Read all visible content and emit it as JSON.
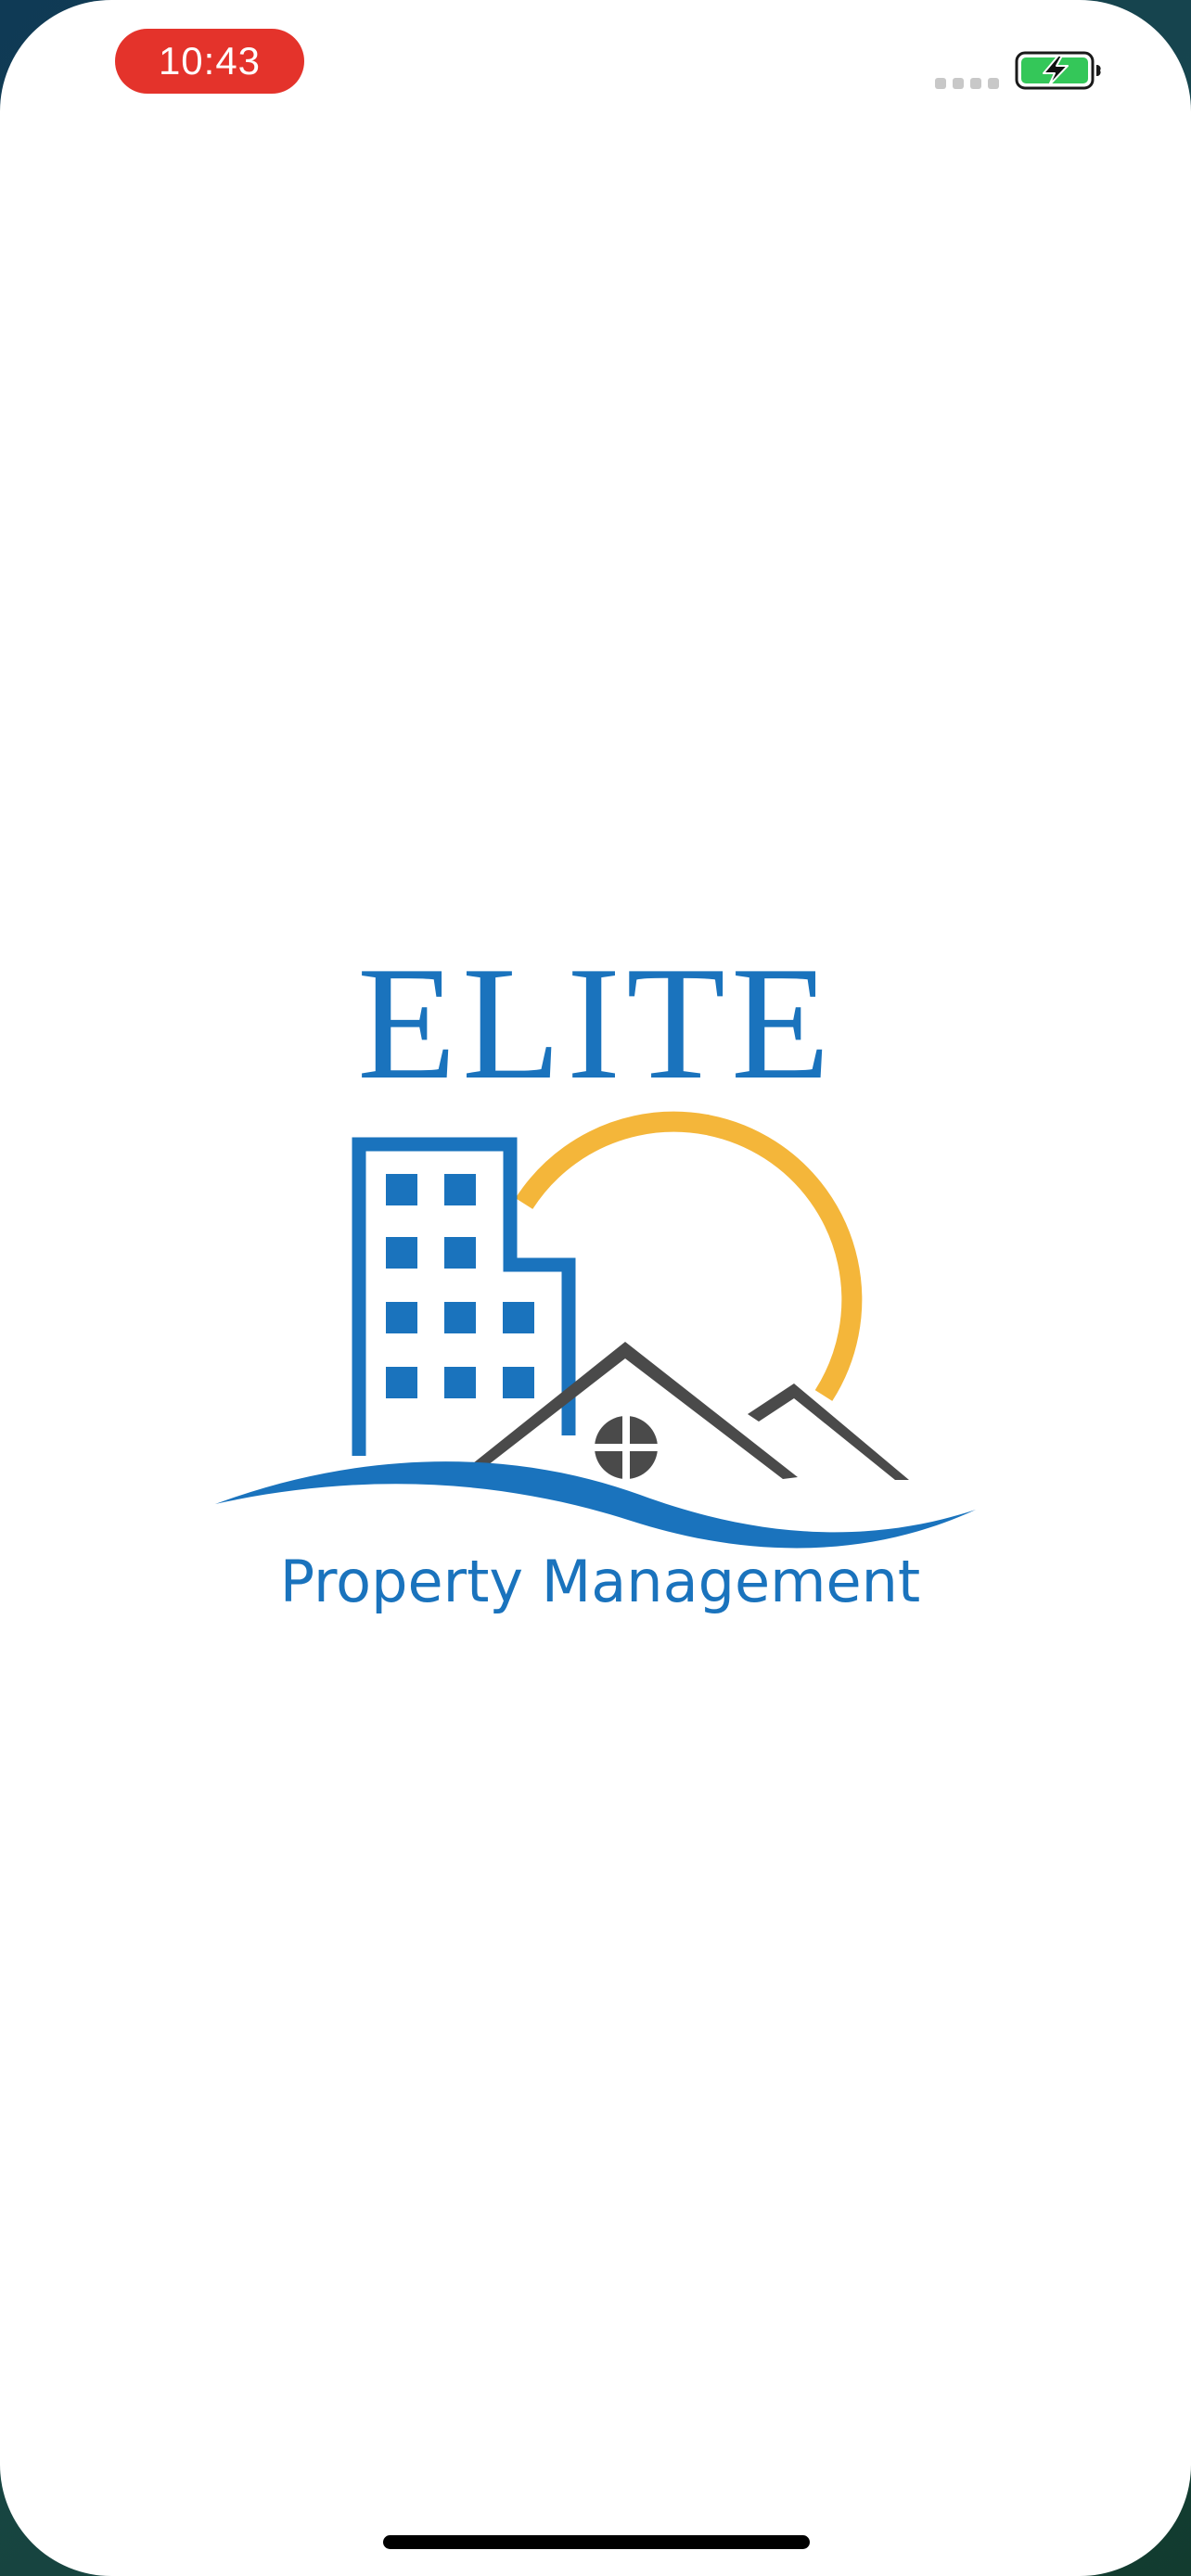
{
  "status_bar": {
    "time": "10:43",
    "recording_indicator_color": "#e4332b",
    "signal_icon": "cellular-signal-icon",
    "battery_icon": "battery-charging-icon",
    "battery_color": "#34c759"
  },
  "splash": {
    "logo_title": "ELITE",
    "logo_subtitle": "Property Management",
    "brand_blue": "#1a73bd",
    "sun_color": "#f4b63a",
    "roof_color": "#4a4a4a",
    "icons": [
      "building-icon",
      "sun-icon",
      "house-roof-icon",
      "round-window-icon",
      "wave-icon"
    ]
  },
  "home_indicator": {
    "color": "#000000"
  }
}
